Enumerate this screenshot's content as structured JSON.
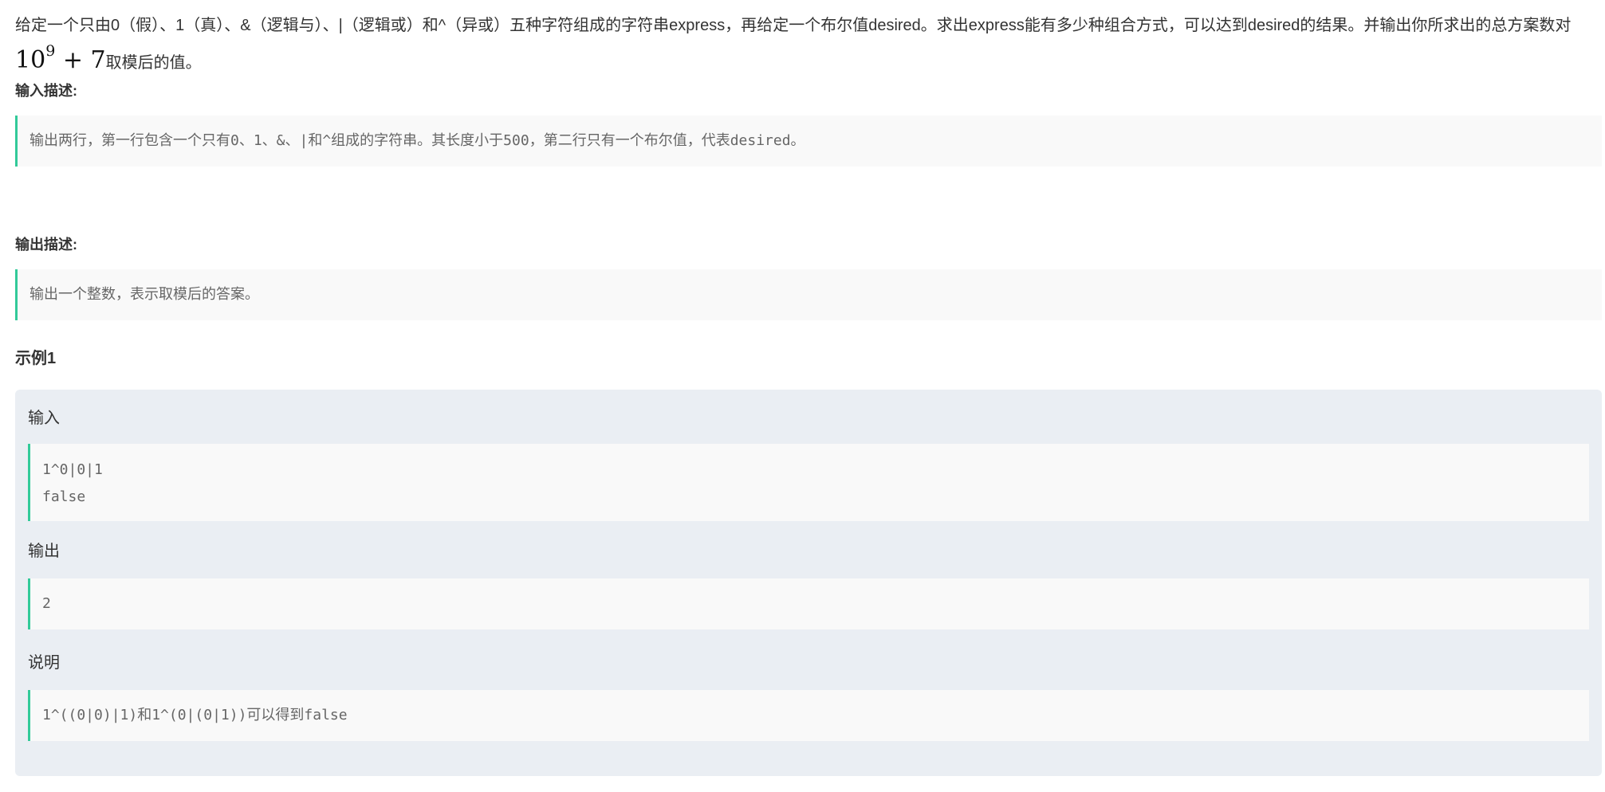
{
  "problem": {
    "description_part1": "给定一个只由0（假）、1（真）、&（逻辑与）、|（逻辑或）和^（异或）五种字符组成的字符串express，再给定一个布尔值desired。求出express能有多少种组合方式，可以达到desired的结果。并输出你所求出的总方案数对",
    "math_base": "10",
    "math_exp": "9",
    "math_tail": " + 7",
    "description_part2": "取模后的值。"
  },
  "input_section": {
    "title": "输入描述:",
    "text": "输出两行，第一行包含一个只有0、1、&、|和^组成的字符串。其长度小于500，第二行只有一个布尔值，代表desired。"
  },
  "output_section": {
    "title": "输出描述:",
    "text": "输出一个整数，表示取模后的答案。"
  },
  "example": {
    "title": "示例1",
    "input_label": "输入",
    "input_lines": [
      "1^0|0|1",
      "false"
    ],
    "output_label": "输出",
    "output_value": "2",
    "explain_label": "说明",
    "explain_text": "1^((0|0)|1)和1^(0|(0|1))可以得到false"
  },
  "colors": {
    "accent": "#32ca99",
    "block_bg": "#f9f9f9",
    "example_bg": "#eaeef3",
    "text": "#333333",
    "code_text": "#666666"
  }
}
